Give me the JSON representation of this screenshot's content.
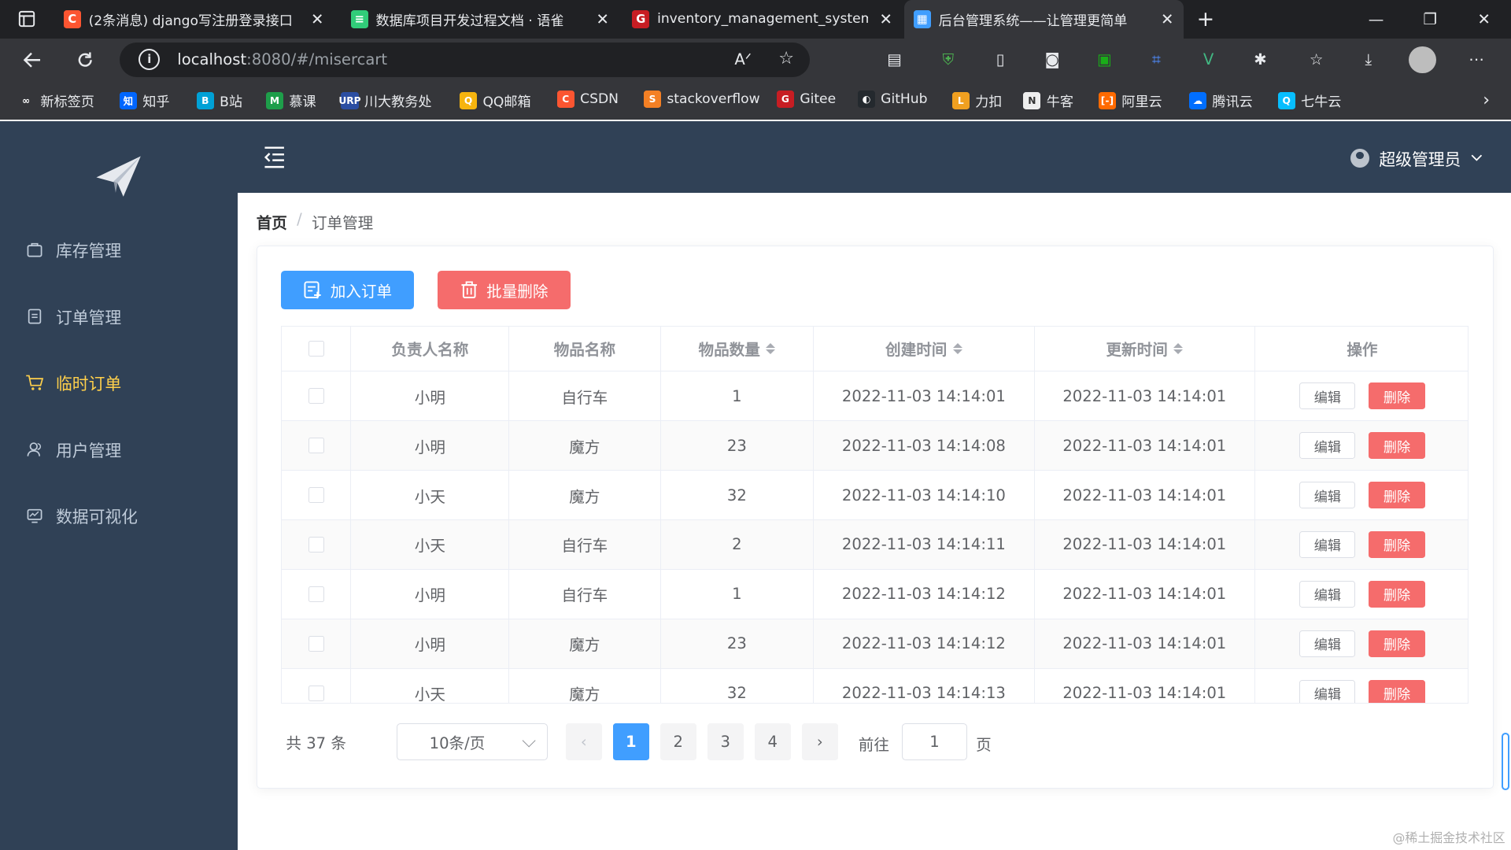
{
  "browser": {
    "tabs": [
      {
        "title": "(2条消息) django写注册登录接口",
        "icon": "C",
        "icon_color": "#fc5531"
      },
      {
        "title": "数据库项目开发过程文档 · 语雀",
        "icon": "≡",
        "icon_color": "#31cc79"
      },
      {
        "title": "inventory_management_system",
        "icon": "G",
        "icon_color": "#c71d23"
      },
      {
        "title": "后台管理系统——让管理更简单",
        "icon": "▦",
        "icon_color": "#409eff"
      }
    ],
    "url_host": "localhost",
    "url_path": ":8080/#/misercart",
    "bookmarks": [
      {
        "label": "新标签页",
        "icon": "∞",
        "color": "#35363a"
      },
      {
        "label": "知乎",
        "icon": "知",
        "color": "#0066ff"
      },
      {
        "label": "B站",
        "icon": "B",
        "color": "#00a1d6"
      },
      {
        "label": "慕课",
        "icon": "M",
        "color": "#1e9e4a"
      },
      {
        "label": "川大教务处",
        "icon": "URP",
        "color": "#2b4ea2"
      },
      {
        "label": "QQ邮箱",
        "icon": "Q",
        "color": "#f6b40e"
      },
      {
        "label": "CSDN",
        "icon": "C",
        "color": "#fc5531"
      },
      {
        "label": "stackoverflow",
        "icon": "S",
        "color": "#f48024"
      },
      {
        "label": "Gitee",
        "icon": "G",
        "color": "#c71d23"
      },
      {
        "label": "GitHub",
        "icon": "◐",
        "color": "#24292e"
      },
      {
        "label": "力扣",
        "icon": "L",
        "color": "#f0a020"
      },
      {
        "label": "牛客",
        "icon": "N",
        "color": "#eeeeee"
      },
      {
        "label": "阿里云",
        "icon": "[-]",
        "color": "#ff6a00"
      },
      {
        "label": "腾讯云",
        "icon": "☁",
        "color": "#006eff"
      },
      {
        "label": "七牛云",
        "icon": "Q",
        "color": "#07beff"
      }
    ]
  },
  "sidebar": {
    "items": [
      {
        "label": "库存管理",
        "icon": "bag-icon"
      },
      {
        "label": "订单管理",
        "icon": "clipboard-icon"
      },
      {
        "label": "临时订单",
        "icon": "cart-icon"
      },
      {
        "label": "用户管理",
        "icon": "users-icon"
      },
      {
        "label": "数据可视化",
        "icon": "chart-icon"
      }
    ],
    "active_index": 2
  },
  "header": {
    "user_name": "超级管理员"
  },
  "breadcrumb": {
    "home": "首页",
    "separator": "/",
    "current": "订单管理"
  },
  "actions": {
    "add_label": "加入订单",
    "batch_delete_label": "批量删除"
  },
  "table": {
    "columns": [
      "负责人名称",
      "物品名称",
      "物品数量",
      "创建时间",
      "更新时间",
      "操作"
    ],
    "rows": [
      [
        "小明",
        "自行车",
        "1",
        "2022-11-03 14:14:01",
        "2022-11-03 14:14:01"
      ],
      [
        "小明",
        "魔方",
        "23",
        "2022-11-03 14:14:08",
        "2022-11-03 14:14:01"
      ],
      [
        "小天",
        "魔方",
        "32",
        "2022-11-03 14:14:10",
        "2022-11-03 14:14:01"
      ],
      [
        "小天",
        "自行车",
        "2",
        "2022-11-03 14:14:11",
        "2022-11-03 14:14:01"
      ],
      [
        "小明",
        "自行车",
        "1",
        "2022-11-03 14:14:12",
        "2022-11-03 14:14:01"
      ],
      [
        "小明",
        "魔方",
        "23",
        "2022-11-03 14:14:12",
        "2022-11-03 14:14:01"
      ],
      [
        "小天",
        "魔方",
        "32",
        "2022-11-03 14:14:13",
        "2022-11-03 14:14:01"
      ]
    ],
    "edit_label": "编辑",
    "delete_label": "删除"
  },
  "pagination": {
    "total": "共 37 条",
    "page_size": "10条/页",
    "pages": [
      "1",
      "2",
      "3",
      "4"
    ],
    "current_page": "1",
    "goto_prefix": "前往",
    "goto_value": "1",
    "goto_suffix": "页"
  },
  "watermark": "@稀土掘金技术社区",
  "colors": {
    "primary": "#409eff",
    "danger": "#f56c6c",
    "sidebar": "#304156",
    "active_menu": "#ffd04b"
  }
}
